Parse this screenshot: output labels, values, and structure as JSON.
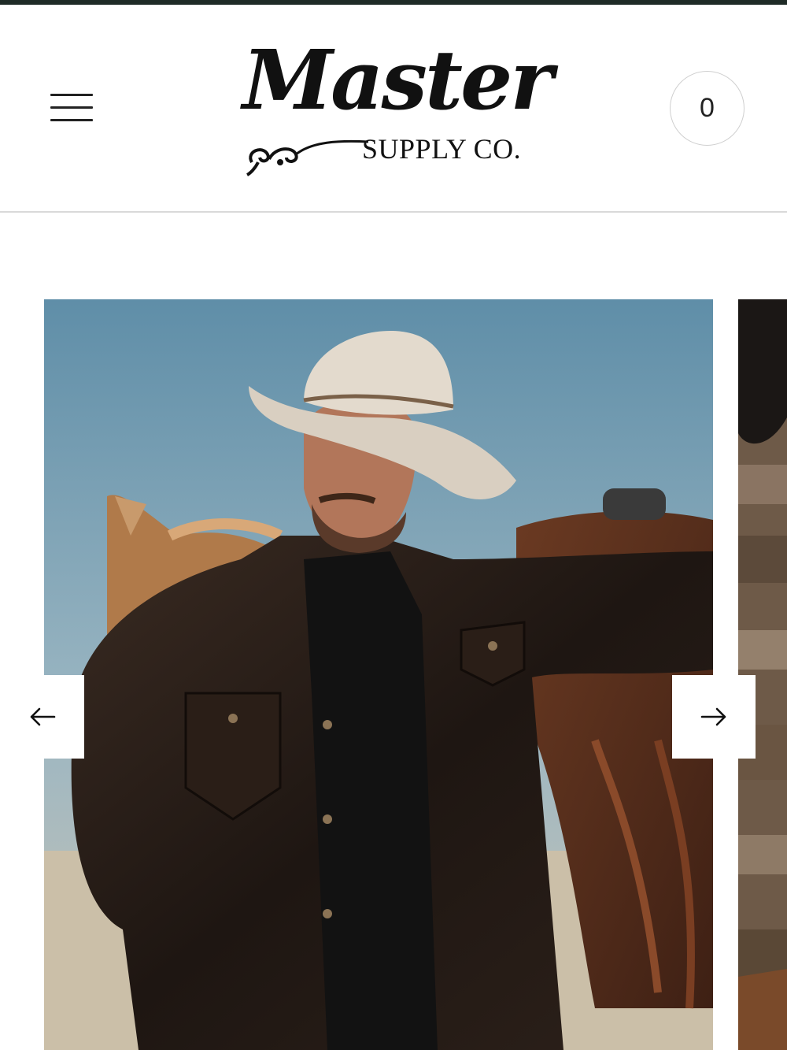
{
  "header": {
    "menu_icon": "hamburger-menu-icon",
    "logo": {
      "script_text": "Master",
      "subtitle": "SUPPLY CO."
    },
    "cart_count": "0"
  },
  "carousel": {
    "prev_icon": "arrow-left-icon",
    "next_icon": "arrow-right-icon"
  },
  "colors": {
    "top_strip": "#1f2b27",
    "background": "#ffffff",
    "text": "#111111",
    "divider": "#d9d9d9"
  }
}
